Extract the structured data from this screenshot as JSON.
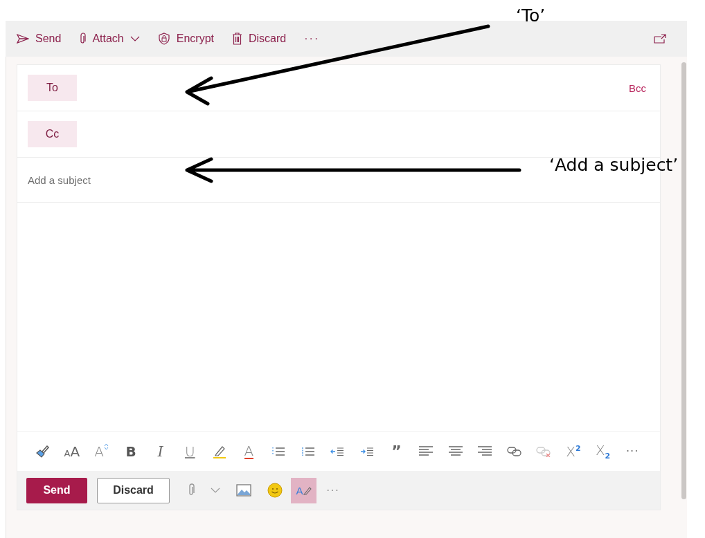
{
  "toolbar": {
    "items": [
      {
        "kind": "send",
        "label": "Send"
      },
      {
        "kind": "attach",
        "label": "Attach"
      },
      {
        "kind": "encrypt",
        "label": "Encrypt"
      },
      {
        "kind": "discard",
        "label": "Discard"
      },
      {
        "kind": "more",
        "label": "···"
      }
    ]
  },
  "compose": {
    "to": {
      "label": "To"
    },
    "bcc": {
      "label": "Bcc"
    },
    "cc": {
      "label": "Cc"
    },
    "subject": {
      "placeholder": "Add a subject"
    }
  },
  "format_toolbar": [
    {
      "kind": "painter"
    },
    {
      "kind": "font-size",
      "glyph_small": "A",
      "glyph": "A"
    },
    {
      "kind": "grow",
      "glyph": "A"
    },
    {
      "kind": "bold",
      "glyph": "B"
    },
    {
      "kind": "italic",
      "glyph": "I"
    },
    {
      "kind": "underline",
      "glyph": "U"
    },
    {
      "kind": "highlight"
    },
    {
      "kind": "font-color",
      "glyph": "A"
    },
    {
      "kind": "bullets"
    },
    {
      "kind": "numbering"
    },
    {
      "kind": "outdent"
    },
    {
      "kind": "indent"
    },
    {
      "kind": "quote",
      "glyph": "”"
    },
    {
      "kind": "align-left"
    },
    {
      "kind": "align-center"
    },
    {
      "kind": "align-right"
    },
    {
      "kind": "link"
    },
    {
      "kind": "unlink",
      "disabled": true
    },
    {
      "kind": "superscript",
      "glyph": "X",
      "index": "2"
    },
    {
      "kind": "subscript",
      "glyph": "X",
      "index": "2"
    },
    {
      "kind": "more",
      "glyph": "···"
    }
  ],
  "actions": {
    "send": "Send",
    "discard": "Discard",
    "editor": {
      "glyph": "A",
      "on": true
    },
    "more": "···"
  },
  "annotations": [
    {
      "text": "‘To’"
    },
    {
      "text": "‘Add a subject’"
    }
  ]
}
